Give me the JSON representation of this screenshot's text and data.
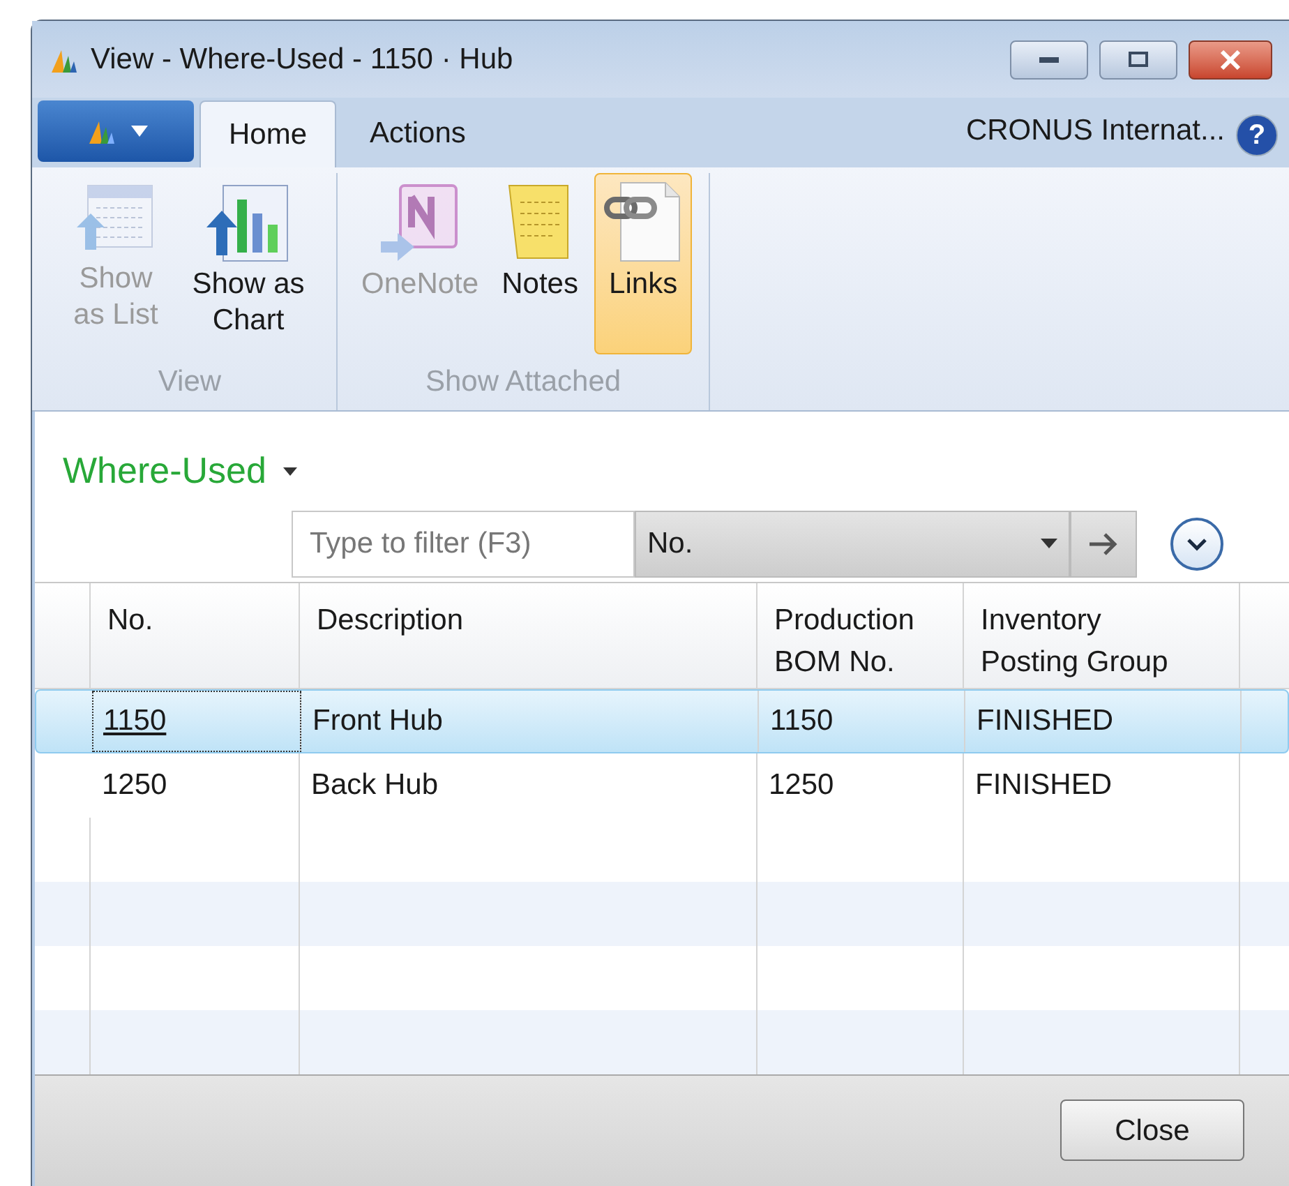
{
  "window": {
    "title": "View - Where-Used - 1150 · Hub"
  },
  "tabs": [
    {
      "label": "Home",
      "selected": true
    },
    {
      "label": "Actions",
      "selected": false
    }
  ],
  "company": "CRONUS Internat...",
  "help": "?",
  "ribbon_groups": [
    {
      "label": "View",
      "buttons": [
        {
          "label": "Show as List",
          "kind": "list",
          "disabled": true,
          "selected": false
        },
        {
          "label": "Show as Chart",
          "kind": "chart",
          "disabled": false,
          "selected": false
        }
      ]
    },
    {
      "label": "Show Attached",
      "buttons": [
        {
          "label": "OneNote",
          "kind": "onenote",
          "disabled": true,
          "selected": false
        },
        {
          "label": "Notes",
          "kind": "notes",
          "disabled": false,
          "selected": false
        },
        {
          "label": "Links",
          "kind": "links",
          "disabled": false,
          "selected": true
        }
      ]
    }
  ],
  "page_title": "Where-Used",
  "filter": {
    "placeholder": "Type to filter (F3)",
    "field": "No."
  },
  "table": {
    "columns": [
      "No.",
      "Description",
      "Production BOM No.",
      "Inventory Posting Group"
    ],
    "rows": [
      {
        "cells": [
          "1150",
          "Front Hub",
          "1150",
          "FINISHED"
        ],
        "selected": true
      },
      {
        "cells": [
          "1250",
          "Back Hub",
          "1250",
          "FINISHED"
        ],
        "selected": false
      }
    ]
  },
  "buttons": [
    "Close"
  ]
}
